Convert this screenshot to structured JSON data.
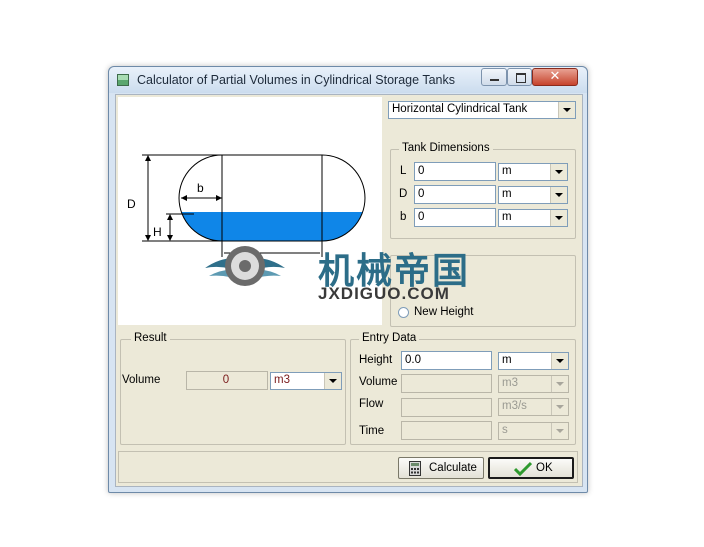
{
  "window": {
    "title": "Calculator of Partial Volumes in Cylindrical Storage Tanks"
  },
  "tank_type": {
    "selected": "Horizontal Cylindrical Tank"
  },
  "diagram": {
    "labels": {
      "D": "D",
      "b": "b",
      "H": "H"
    }
  },
  "tank_dimensions": {
    "title": "Tank Dimensions",
    "rows": [
      {
        "label": "L",
        "value": "0",
        "unit": "m"
      },
      {
        "label": "D",
        "value": "0",
        "unit": "m"
      },
      {
        "label": "b",
        "value": "0",
        "unit": "m"
      }
    ]
  },
  "calc_mode": {
    "new_height_label": "New Height"
  },
  "result": {
    "title": "Result",
    "volume_label": "Volume",
    "volume_value": "0",
    "volume_unit": "m3"
  },
  "entry_data": {
    "title": "Entry Data",
    "height_label": "Height",
    "height_value": "0.0",
    "height_unit": "m",
    "volume_label": "Volume",
    "volume_unit": "m3",
    "flow_label": "Flow",
    "flow_unit": "m3/s",
    "time_label": "Time",
    "time_unit": "s"
  },
  "buttons": {
    "calculate": "Calculate",
    "ok": "OK"
  },
  "watermark": {
    "chinese": "机械帝国",
    "latin": "JXDIGUO.COM"
  },
  "colors": {
    "liquid": "#0f86e8",
    "client_bg": "#ece9d8",
    "accent_check": "#2e9a2e"
  }
}
